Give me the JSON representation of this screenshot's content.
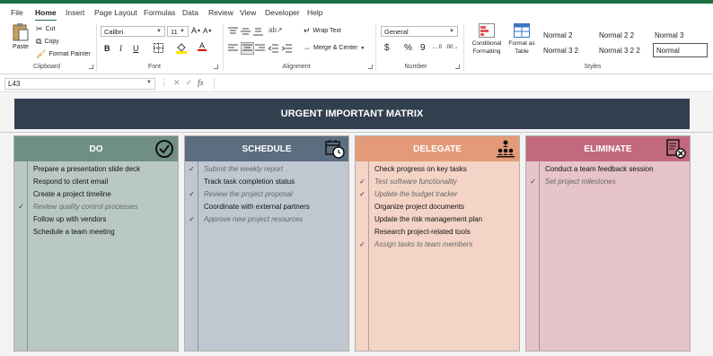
{
  "menu": {
    "items": [
      "File",
      "Home",
      "Insert",
      "Page Layout",
      "Formulas",
      "Data",
      "Review",
      "View",
      "Developer",
      "Help"
    ],
    "active": "Home"
  },
  "ribbon": {
    "clipboard": {
      "paste": "Paste",
      "cut": "Cut",
      "copy": "Copy",
      "format_painter": "Format Painter",
      "label": "Clipboard"
    },
    "font": {
      "name": "Calibri",
      "size": "11",
      "bold": "B",
      "italic": "I",
      "underline": "U",
      "label": "Font"
    },
    "alignment": {
      "wrap": "Wrap Text",
      "merge": "Merge & Center",
      "label": "Alignment"
    },
    "number": {
      "format": "General",
      "currency": "$",
      "percent": "%",
      "comma": "9",
      "label": "Number"
    },
    "styles": {
      "conditional": "Conditional Formatting",
      "format_table": "Format as Table",
      "cells": [
        "Normal 2",
        "Normal 2 2",
        "Normal 3",
        "Normal 3 2",
        "Normal 3 2 2",
        "Normal"
      ],
      "label": "Styles"
    }
  },
  "formula_bar": {
    "name_box": "L43",
    "fx": "fx",
    "value": ""
  },
  "matrix": {
    "title": "URGENT IMPORTANT MATRIX",
    "columns": [
      {
        "name": "DO",
        "header_color": "#6f8f86",
        "body_color": "#b9c9c2",
        "icon": "check-circle-icon",
        "tasks": [
          {
            "text": "Prepare a presentation slide deck",
            "done": false
          },
          {
            "text": "Respond to client email",
            "done": false
          },
          {
            "text": "Create a project timeline",
            "done": false
          },
          {
            "text": "Review quality control processes",
            "done": true
          },
          {
            "text": "Follow up with vendors",
            "done": false
          },
          {
            "text": "Schedule a team meeting",
            "done": false
          }
        ]
      },
      {
        "name": "SCHEDULE",
        "header_color": "#5c6d80",
        "body_color": "#bfc8d0",
        "icon": "calendar-clock-icon",
        "tasks": [
          {
            "text": "Submit the weekly report",
            "done": true
          },
          {
            "text": "Track task completion status",
            "done": false
          },
          {
            "text": "Review the project proposal",
            "done": true
          },
          {
            "text": "Coordinate with external partners",
            "done": false
          },
          {
            "text": "Approve new project resources",
            "done": true
          }
        ]
      },
      {
        "name": "DELEGATE",
        "header_color": "#e49a78",
        "body_color": "#f4d4c6",
        "icon": "org-chart-icon",
        "tasks": [
          {
            "text": "Check progress on key tasks",
            "done": false
          },
          {
            "text": "Test software functionality",
            "done": true
          },
          {
            "text": "Update the budget tracker",
            "done": true
          },
          {
            "text": "Organize project documents",
            "done": false
          },
          {
            "text": "Update the risk management plan",
            "done": false
          },
          {
            "text": "Research project-related tools",
            "done": false
          },
          {
            "text": "Assign tasks to team members",
            "done": true
          }
        ]
      },
      {
        "name": "ELIMINATE",
        "header_color": "#c3697e",
        "body_color": "#e7c3cb",
        "icon": "document-cancel-icon",
        "tasks": [
          {
            "text": "Conduct a team feedback session",
            "done": false
          },
          {
            "text": "Set project milestones",
            "done": true
          }
        ]
      }
    ]
  },
  "colors": {
    "accent": "#1e7145",
    "title_bar": "#323f4f"
  }
}
